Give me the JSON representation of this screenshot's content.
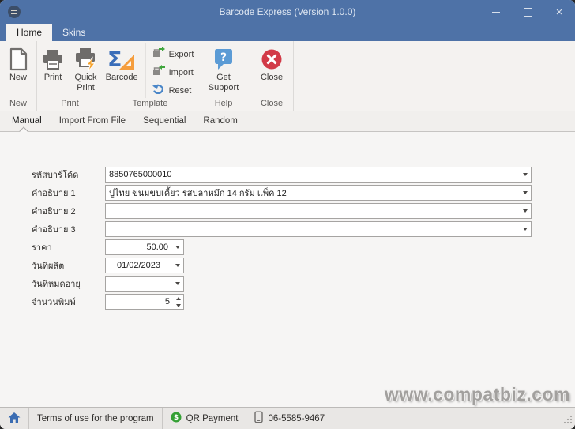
{
  "window": {
    "title": "Barcode Express (Version 1.0.0)",
    "controls": {
      "minimize": "minimize",
      "maximize": "maximize",
      "close": "×"
    }
  },
  "ribbon_tabs": [
    {
      "label": "Home",
      "active": true
    },
    {
      "label": "Skins",
      "active": false
    }
  ],
  "ribbon_groups": [
    {
      "label": "New"
    },
    {
      "label": "Print"
    },
    {
      "label": "Template"
    },
    {
      "label": "Help"
    },
    {
      "label": "Close"
    }
  ],
  "buttons": {
    "new": "New",
    "print": "Print",
    "quick_print": "Quick Print",
    "barcode": "Barcode",
    "export": "Export",
    "import": "Import",
    "reset": "Reset",
    "get_support": "Get Support",
    "close": "Close"
  },
  "mode_tabs": [
    {
      "label": "Manual",
      "active": true
    },
    {
      "label": "Import From File",
      "active": false
    },
    {
      "label": "Sequential",
      "active": false
    },
    {
      "label": "Random",
      "active": false
    }
  ],
  "form": {
    "fields": [
      {
        "label": "รหัสบาร์โค้ด",
        "value": "8850765000010"
      },
      {
        "label": "คำอธิบาย 1",
        "value": "ปูไทย ขนมขบเคี้ยว รสปลาหมึก 14 กรัม แพ็ค 12"
      },
      {
        "label": "คำอธิบาย 2",
        "value": ""
      },
      {
        "label": "คำอธิบาย 3",
        "value": ""
      },
      {
        "label": "ราคา",
        "value": "50.00"
      },
      {
        "label": "วันที่ผลิต",
        "value": "01/02/2023"
      },
      {
        "label": "วันที่หมดอายุ",
        "value": ""
      },
      {
        "label": "จำนวนพิมพ์",
        "value": "5"
      }
    ]
  },
  "watermark": "www.compatbiz.com",
  "statusbar": {
    "terms": "Terms of use for the program",
    "qr_payment": "QR Payment",
    "phone": "06-5585-9467"
  },
  "colors": {
    "titlebar_blue": "#4e72a7",
    "ribbon_bg": "#f4f2f0",
    "close_red": "#d23a47",
    "support_blue": "#5b9bd5",
    "barcode_blue": "#3a6db8",
    "accent_orange": "#f59d3d",
    "arrow_green": "#3fa53c",
    "home_blue": "#3a6cb2",
    "coin_green": "#35a035"
  }
}
